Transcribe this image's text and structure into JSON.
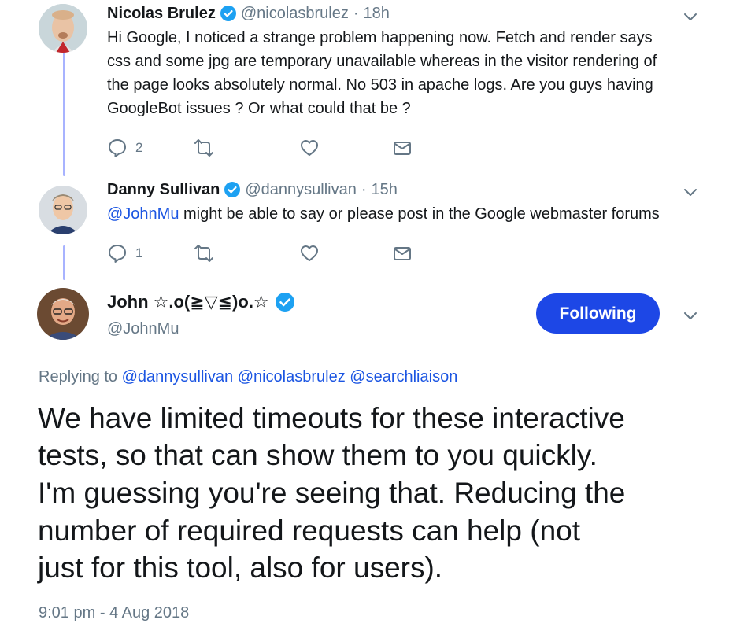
{
  "tweets": [
    {
      "name": "Nicolas Brulez",
      "handle": "@nicolasbrulez",
      "separator": "·",
      "time": "18h",
      "text_lines": [
        "Hi Google, I noticed a strange problem happening now. Fetch and render says",
        "css and some jpg are temporary unavailable whereas in the visitor rendering of",
        "the page looks absolutely normal. No 503 in apache logs. Are you guys having",
        "GoogleBot issues ? Or what could that be ?"
      ],
      "reply_count": "2",
      "verified": true
    },
    {
      "name": "Danny Sullivan",
      "handle": "@dannysullivan",
      "separator": "·",
      "time": "15h",
      "mention": "@JohnMu",
      "text_rest": " might be able to say or please post in the Google webmaster forums",
      "reply_count": "1",
      "verified": true
    }
  ],
  "main_tweet": {
    "name": "John ☆.o(≧▽≦)o.☆",
    "handle": "@JohnMu",
    "verified": true,
    "follow_label": "Following",
    "replying_prefix": "Replying to",
    "replying_to": [
      "@dannysullivan",
      "@nicolasbrulez",
      "@searchliaison"
    ],
    "text_lines": [
      "We have limited timeouts for these interactive",
      "tests, so that can show them to you quickly.",
      "I'm guessing you're seeing that. Reducing the",
      "number of required requests can help (not",
      "just for this tool, also for users)."
    ],
    "timestamp": "9:01 pm - 4 Aug 2018"
  },
  "icons": {
    "reply": "reply-icon",
    "retweet": "retweet-icon",
    "like": "heart-icon",
    "dm": "envelope-icon",
    "more": "chevron-down-icon",
    "verified": "verified-badge-icon"
  },
  "colors": {
    "accent": "#1d47e6",
    "mention": "#1b55e2",
    "muted": "#657786",
    "thread_line": "#a8b3ff",
    "verified": "#1da1f2"
  }
}
